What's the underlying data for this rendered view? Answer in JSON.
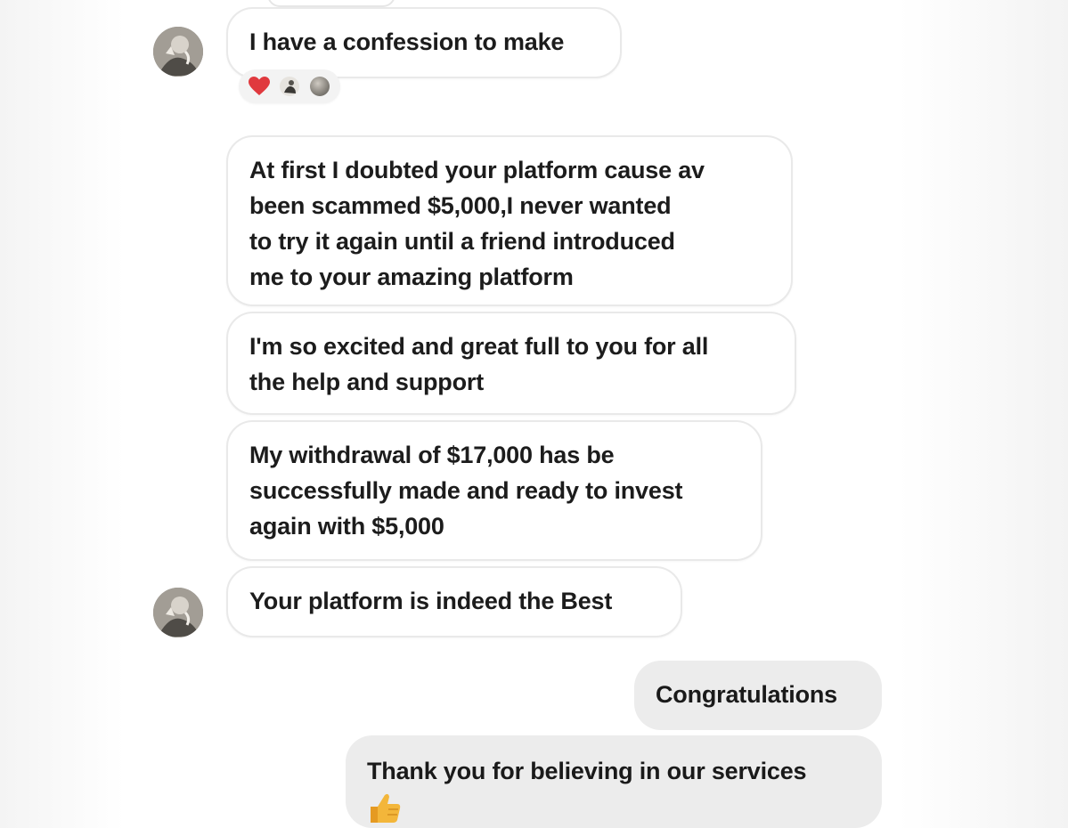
{
  "conversation": {
    "incoming_messages": [
      {
        "id": "m1",
        "text": "I have a confession to make"
      },
      {
        "id": "m2",
        "lines": [
          "At first I doubted your platform cause av",
          "been scammed $5,000,I never wanted",
          "to try it again until a friend introduced",
          "me to your amazing platform"
        ]
      },
      {
        "id": "m3",
        "lines": [
          "I'm so excited and great full to you for all",
          "the help and support"
        ]
      },
      {
        "id": "m4",
        "lines": [
          "My withdrawal of $17,000 has be",
          "successfully made and ready to invest",
          "again with $5,000"
        ]
      },
      {
        "id": "m5",
        "text": "Your platform is indeed the Best"
      }
    ],
    "reactions": [
      {
        "icon": "heart-emoji"
      },
      {
        "icon": "reaction-avatar-small"
      },
      {
        "icon": "reaction-avatar-small"
      }
    ],
    "outgoing_messages": [
      {
        "id": "o1",
        "text": "Congratulations"
      },
      {
        "id": "o2",
        "text": "Thank you for believing in our services",
        "emoji": "thumbs-up-emoji"
      }
    ]
  },
  "colors": {
    "incoming_bubble_bg": "#ffffff",
    "incoming_bubble_border": "#e9e9e9",
    "outgoing_bubble_bg": "#ececec",
    "text": "#1c1c1c",
    "heart": "#e0393e",
    "thumb": "#f3b63a"
  }
}
